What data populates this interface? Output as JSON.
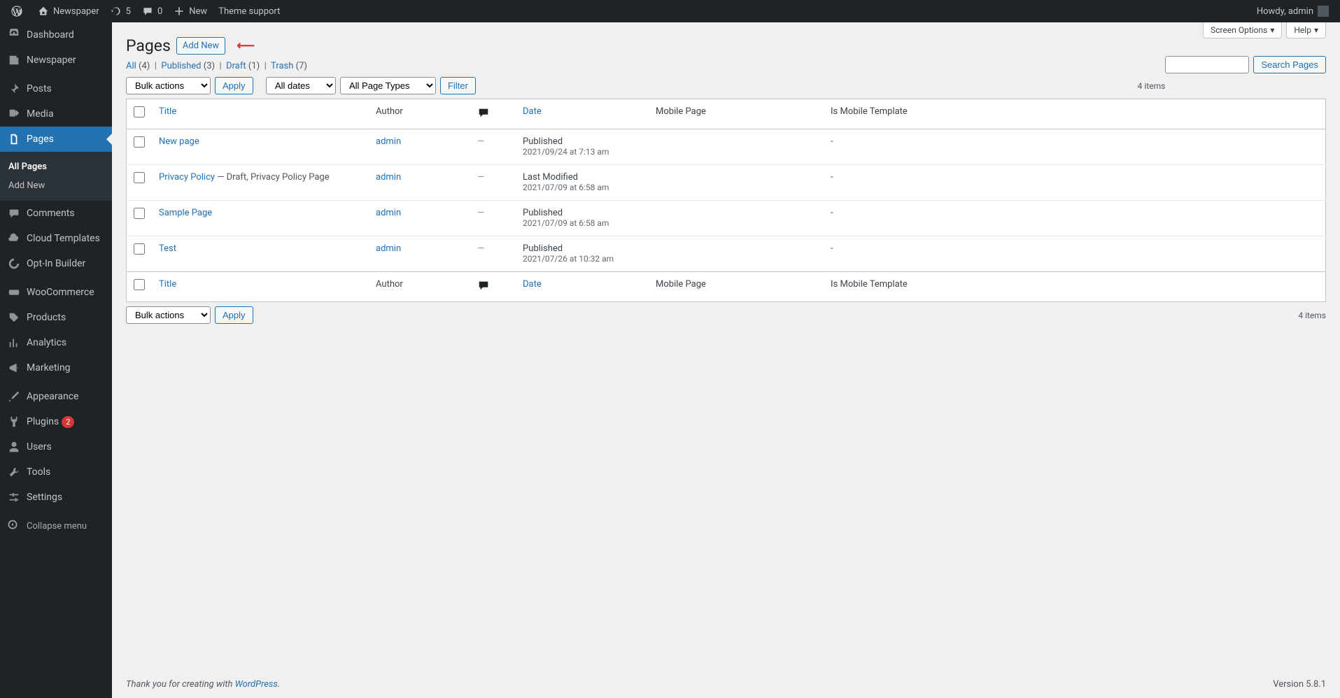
{
  "adminbar": {
    "site_name": "Newspaper",
    "updates_count": "5",
    "comments_count": "0",
    "new_label": "New",
    "theme_support": "Theme support",
    "howdy": "Howdy, admin"
  },
  "sidebar": {
    "items": [
      {
        "label": "Dashboard"
      },
      {
        "label": "Newspaper"
      },
      {
        "label": "Posts"
      },
      {
        "label": "Media"
      },
      {
        "label": "Pages"
      },
      {
        "label": "Comments"
      },
      {
        "label": "Cloud Templates"
      },
      {
        "label": "Opt-In Builder"
      },
      {
        "label": "WooCommerce"
      },
      {
        "label": "Products"
      },
      {
        "label": "Analytics"
      },
      {
        "label": "Marketing"
      },
      {
        "label": "Appearance"
      },
      {
        "label": "Plugins"
      },
      {
        "label": "Users"
      },
      {
        "label": "Tools"
      },
      {
        "label": "Settings"
      }
    ],
    "plugins_badge": "2",
    "submenu": {
      "all_pages": "All Pages",
      "add_new": "Add New"
    },
    "collapse_label": "Collapse menu"
  },
  "header": {
    "title": "Pages",
    "add_new": "Add New",
    "screen_options": "Screen Options",
    "help": "Help"
  },
  "filters": {
    "subsubsub": {
      "all": "All",
      "all_n": "(4)",
      "published": "Published",
      "published_n": "(3)",
      "draft": "Draft",
      "draft_n": "(1)",
      "trash": "Trash",
      "trash_n": "(7)"
    },
    "search_label": "Search Pages",
    "bulk_actions": "Bulk actions",
    "apply": "Apply",
    "all_dates": "All dates",
    "all_page_types": "All Page Types",
    "filter": "Filter",
    "items_count": "4 items"
  },
  "table": {
    "cols": {
      "title": "Title",
      "author": "Author",
      "date": "Date",
      "mobile_page": "Mobile Page",
      "is_mobile_template": "Is Mobile Template"
    },
    "rows": [
      {
        "title": "New page",
        "suffix": "",
        "author": "admin",
        "status": "Published",
        "datetime": "2021/09/24 at 7:13 am",
        "mobile": "-"
      },
      {
        "title": "Privacy Policy",
        "suffix": " — Draft, Privacy Policy Page",
        "author": "admin",
        "status": "Last Modified",
        "datetime": "2021/07/09 at 6:58 am",
        "mobile": "-"
      },
      {
        "title": "Sample Page",
        "suffix": "",
        "author": "admin",
        "status": "Published",
        "datetime": "2021/07/09 at 6:58 am",
        "mobile": "-"
      },
      {
        "title": "Test",
        "suffix": "",
        "author": "admin",
        "status": "Published",
        "datetime": "2021/07/26 at 10:32 am",
        "mobile": "-"
      }
    ]
  },
  "footer": {
    "thankyou_prefix": "Thank you for creating with ",
    "wordpress": "WordPress",
    "version": "Version 5.8.1"
  }
}
